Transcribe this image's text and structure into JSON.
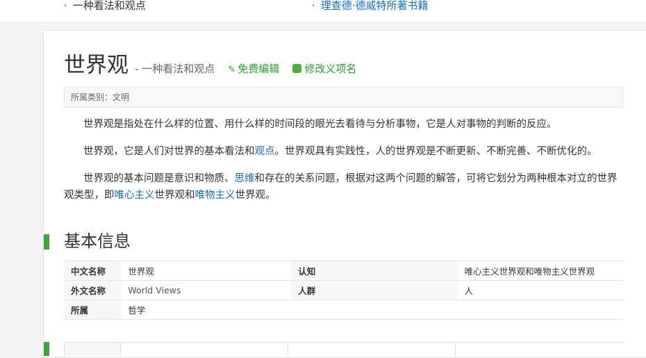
{
  "related": {
    "left_bullet": "·",
    "left_text": "一种看法和观点",
    "right_bullet": "·",
    "right_text": "理查德·德威特所著书籍"
  },
  "entry": {
    "title": "世界观",
    "subtitle": "- 一种看法和观点",
    "edit_label": "免费编辑",
    "rename_label": "修改义项名",
    "category_label": "所属类别：文明"
  },
  "paragraphs": {
    "p1": "世界观是指处在什么样的位置、用什么样的时间段的眼光去看待与分析事物，它是人对事物的判断的反应。",
    "p2": {
      "before": "世界观，它是人们对世界的基本看法和",
      "link": "观点",
      "after": "。世界观具有实践性，人的世界观是不断更新、不断完善、不断优化的。"
    },
    "p3": {
      "a": "世界观的基本问题是意识和物质、",
      "link1": "思维",
      "b": "和存在的关系问题，根据对这两个问题的解答，可将它划分为两种根本对立的世界观类型，即",
      "link2": "唯心主义",
      "c": "世界观和",
      "link3": "唯物主义",
      "d": "世界观。"
    }
  },
  "basic_info": {
    "heading": "基本信息",
    "rows": [
      {
        "k1": "中文名称",
        "v1": "世界观",
        "k2": "认知",
        "v2": "唯心主义世界观和唯物主义世界观"
      },
      {
        "k1": "外文名称",
        "v1": "World Views",
        "k2": "人群",
        "v2": "人"
      },
      {
        "k1": "所属",
        "v1": "哲学",
        "k2": "",
        "v2": ""
      }
    ]
  },
  "colors": {
    "accent_green": "#3fa33a",
    "link_blue": "#136ec2",
    "action_green": "#27a325"
  }
}
